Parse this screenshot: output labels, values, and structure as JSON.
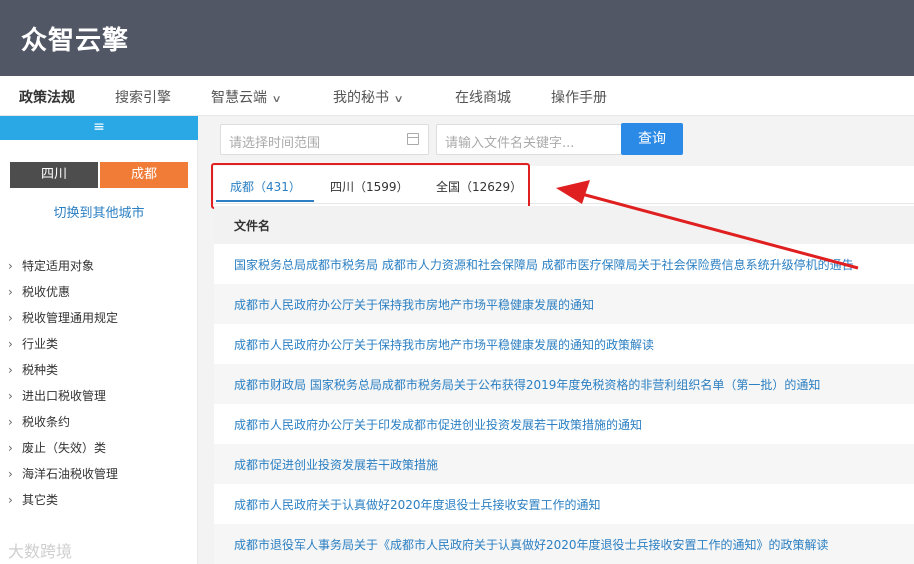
{
  "app": {
    "logo": "众智云擎"
  },
  "nav": {
    "items": [
      {
        "label": "政策法规",
        "active": true,
        "dropdown": false
      },
      {
        "label": "搜索引擎",
        "active": false,
        "dropdown": false
      },
      {
        "label": "智慧云端",
        "active": false,
        "dropdown": true
      },
      {
        "label": "我的秘书",
        "active": false,
        "dropdown": true
      },
      {
        "label": "在线商城",
        "active": false,
        "dropdown": false
      },
      {
        "label": "操作手册",
        "active": false,
        "dropdown": false
      }
    ]
  },
  "sidebar": {
    "menu_icon": "hamburger-icon",
    "city_tabs": [
      {
        "label": "四川",
        "active": false
      },
      {
        "label": "成都",
        "active": true
      }
    ],
    "switch_link": "切换到其他城市",
    "categories": [
      "特定适用对象",
      "税收优惠",
      "税收管理通用规定",
      "行业类",
      "税种类",
      "进出口税收管理",
      "税收条约",
      "废止（失效）类",
      "海洋石油税收管理",
      "其它类"
    ],
    "watermark": "大数跨境"
  },
  "search": {
    "date_placeholder": "请选择时间范围",
    "keyword_placeholder": "请输入文件名关键字...",
    "button_label": "查询"
  },
  "tabs": [
    {
      "label": "成都（431）",
      "active": true
    },
    {
      "label": "四川（1599）",
      "active": false
    },
    {
      "label": "全国（12629）",
      "active": false
    }
  ],
  "table": {
    "header": "文件名",
    "rows": [
      "国家税务总局成都市税务局 成都市人力资源和社会保障局 成都市医疗保障局关于社会保险费信息系统升级停机的通告",
      "成都市人民政府办公厅关于保持我市房地产市场平稳健康发展的通知",
      "成都市人民政府办公厅关于保持我市房地产市场平稳健康发展的通知的政策解读",
      "成都市财政局 国家税务总局成都市税务局关于公布获得2019年度免税资格的非营利组织名单（第一批）的通知",
      "成都市人民政府办公厅关于印发成都市促进创业投资发展若干政策措施的通知",
      "成都市促进创业投资发展若干政策措施",
      "成都市人民政府关于认真做好2020年度退役士兵接收安置工作的通知",
      "成都市退役军人事务局关于《成都市人民政府关于认真做好2020年度退役士兵接收安置工作的通知》的政策解读"
    ]
  },
  "colors": {
    "topbar": "#525766",
    "accent": "#2b7fc2",
    "city_active": "#f07c38",
    "annotation": "#e02020"
  }
}
